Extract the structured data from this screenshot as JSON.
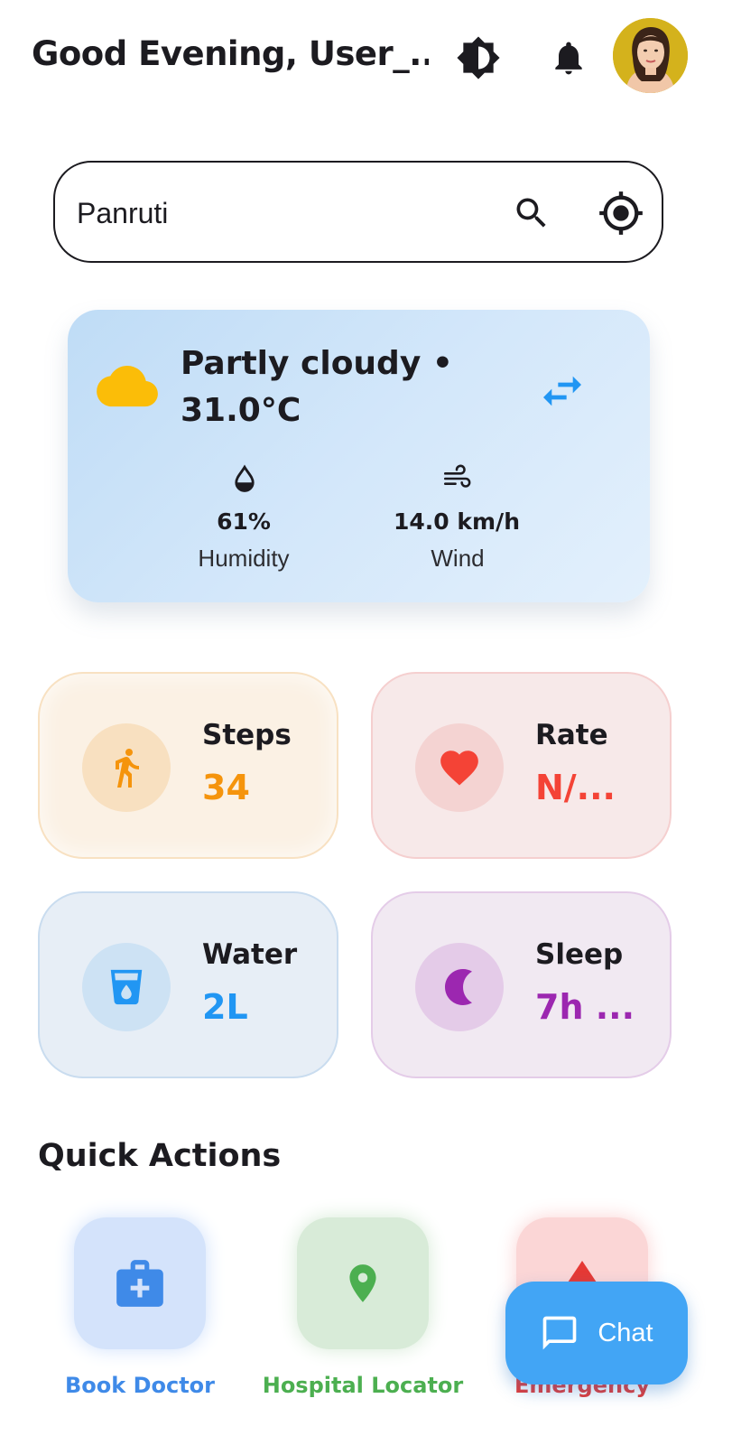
{
  "header": {
    "greeting": "Good Evening, User_...",
    "theme_icon": "brightness-icon",
    "notification_icon": "bell-icon",
    "avatar_icon": "user-avatar"
  },
  "search": {
    "value": "Panruti",
    "search_icon": "search-icon",
    "location_icon": "my-location-icon"
  },
  "weather": {
    "condition_line": "Partly cloudy •",
    "temperature": "31.0°C",
    "humidity": {
      "value": "61%",
      "label": "Humidity"
    },
    "wind": {
      "value": "14.0 km/h",
      "label": "Wind"
    },
    "colors": {
      "cloud": "#fbbd08",
      "swap": "#2196f3"
    }
  },
  "stats": [
    {
      "title": "Steps",
      "value": "34",
      "icon": "walk-icon",
      "color": "#f5940c"
    },
    {
      "title": "Rate",
      "value": "N/...",
      "icon": "heart-icon",
      "color": "#f44336"
    },
    {
      "title": "Water",
      "value": "2L",
      "icon": "water-glass-icon",
      "color": "#2196f3"
    },
    {
      "title": "Sleep",
      "value": "7h ...",
      "icon": "moon-icon",
      "color": "#9c27b0"
    }
  ],
  "quick_actions": {
    "title": "Quick Actions",
    "items": [
      {
        "label": "Book Doctor",
        "icon": "medical-bag-icon",
        "color": "#3f8ae8"
      },
      {
        "label": "Hospital Locator",
        "icon": "location-pin-icon",
        "color": "#4caf50"
      },
      {
        "label": "Emergency",
        "icon": "emergency-icon",
        "color": "#e53935"
      }
    ]
  },
  "chat": {
    "label": "Chat",
    "icon": "chat-bubble-icon"
  }
}
